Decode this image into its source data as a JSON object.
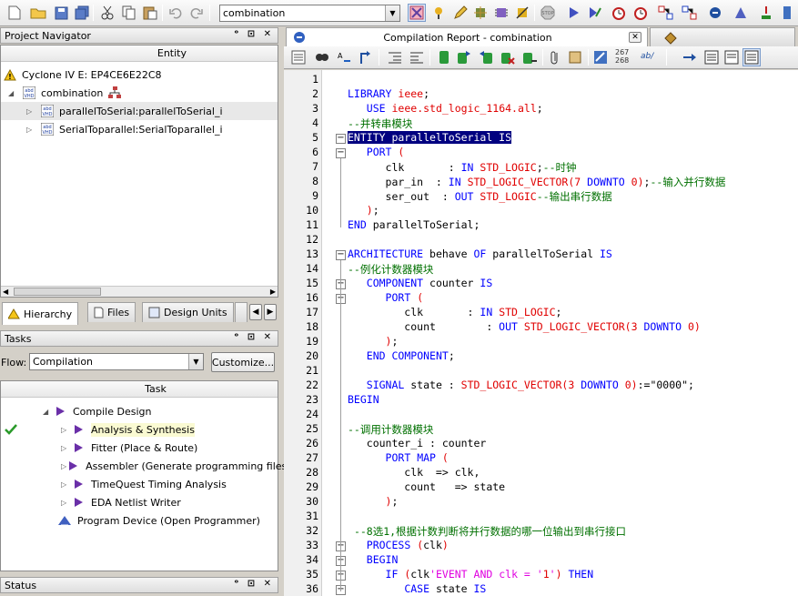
{
  "toolbar": {
    "revision_combo": "combination"
  },
  "project_navigator": {
    "title": "Project Navigator",
    "column": "Entity",
    "device": "Cyclone IV E: EP4CE6E22C8",
    "top_entity": "combination",
    "children": [
      "parallelToSerial:parallelToSerial_i",
      "SerialToparallel:SerialToparallel_i"
    ],
    "tabs": [
      "Hierarchy",
      "Files",
      "Design Units"
    ]
  },
  "tasks": {
    "title": "Tasks",
    "flow_label": "Flow:",
    "flow_value": "Compilation",
    "customize_label": "Customize...",
    "column": "Task",
    "items": [
      {
        "label": "Compile Design"
      },
      {
        "label": "Analysis & Synthesis"
      },
      {
        "label": "Fitter (Place & Route)"
      },
      {
        "label": "Assembler (Generate programming files)"
      },
      {
        "label": "TimeQuest Timing Analysis"
      },
      {
        "label": "EDA Netlist Writer"
      },
      {
        "label": "Program Device (Open Programmer)"
      }
    ]
  },
  "status": {
    "title": "Status"
  },
  "editor": {
    "tab_title": "Compilation Report - combination",
    "toolbar_counter": "267\n268",
    "lines": [
      {
        "n": "1",
        "t": ""
      },
      {
        "n": "2",
        "t": "LIBRARY ieee;"
      },
      {
        "n": "3",
        "t": "   USE ieee.std_logic_1164.all;"
      },
      {
        "n": "4",
        "t": "--并转串模块"
      },
      {
        "n": "5",
        "t": "ENTITY parallelToSerial IS"
      },
      {
        "n": "6",
        "t": "   PORT ("
      },
      {
        "n": "7",
        "t": "      clk       : IN STD_LOGIC;--时钟"
      },
      {
        "n": "8",
        "t": "      par_in  : IN STD_LOGIC_VECTOR(7 DOWNTO 0);--输入并行数据"
      },
      {
        "n": "9",
        "t": "      ser_out  : OUT STD_LOGIC--输出串行数据"
      },
      {
        "n": "10",
        "t": "   );"
      },
      {
        "n": "11",
        "t": "END parallelToSerial;"
      },
      {
        "n": "12",
        "t": ""
      },
      {
        "n": "13",
        "t": "ARCHITECTURE behave OF parallelToSerial IS"
      },
      {
        "n": "14",
        "t": "--例化计数器模块"
      },
      {
        "n": "15",
        "t": "   COMPONENT counter IS"
      },
      {
        "n": "16",
        "t": "      PORT ("
      },
      {
        "n": "17",
        "t": "         clk       : IN STD_LOGIC;"
      },
      {
        "n": "18",
        "t": "         count        : OUT STD_LOGIC_VECTOR(3 DOWNTO 0)"
      },
      {
        "n": "19",
        "t": "      );"
      },
      {
        "n": "20",
        "t": "   END COMPONENT;"
      },
      {
        "n": "21",
        "t": ""
      },
      {
        "n": "22",
        "t": "   SIGNAL state : STD_LOGIC_VECTOR(3 DOWNTO 0):=\"0000\";"
      },
      {
        "n": "23",
        "t": "BEGIN"
      },
      {
        "n": "24",
        "t": ""
      },
      {
        "n": "25",
        "t": "--调用计数器模块"
      },
      {
        "n": "26",
        "t": "   counter_i : counter"
      },
      {
        "n": "27",
        "t": "      PORT MAP ("
      },
      {
        "n": "28",
        "t": "         clk  => clk,"
      },
      {
        "n": "29",
        "t": "         count   => state"
      },
      {
        "n": "30",
        "t": "      );"
      },
      {
        "n": "31",
        "t": ""
      },
      {
        "n": "32",
        "t": " --8选1,根据计数判断将并行数据的哪一位输出到串行接口"
      },
      {
        "n": "33",
        "t": "   PROCESS (clk)"
      },
      {
        "n": "34",
        "t": "   BEGIN"
      },
      {
        "n": "35",
        "t": "      IF (clk'EVENT AND clk = '1') THEN"
      },
      {
        "n": "36",
        "t": "         CASE state IS"
      }
    ]
  },
  "colors": {
    "keyword": "#0000ff",
    "type": "#e00000",
    "comment": "#007000",
    "selection": "#000080"
  }
}
